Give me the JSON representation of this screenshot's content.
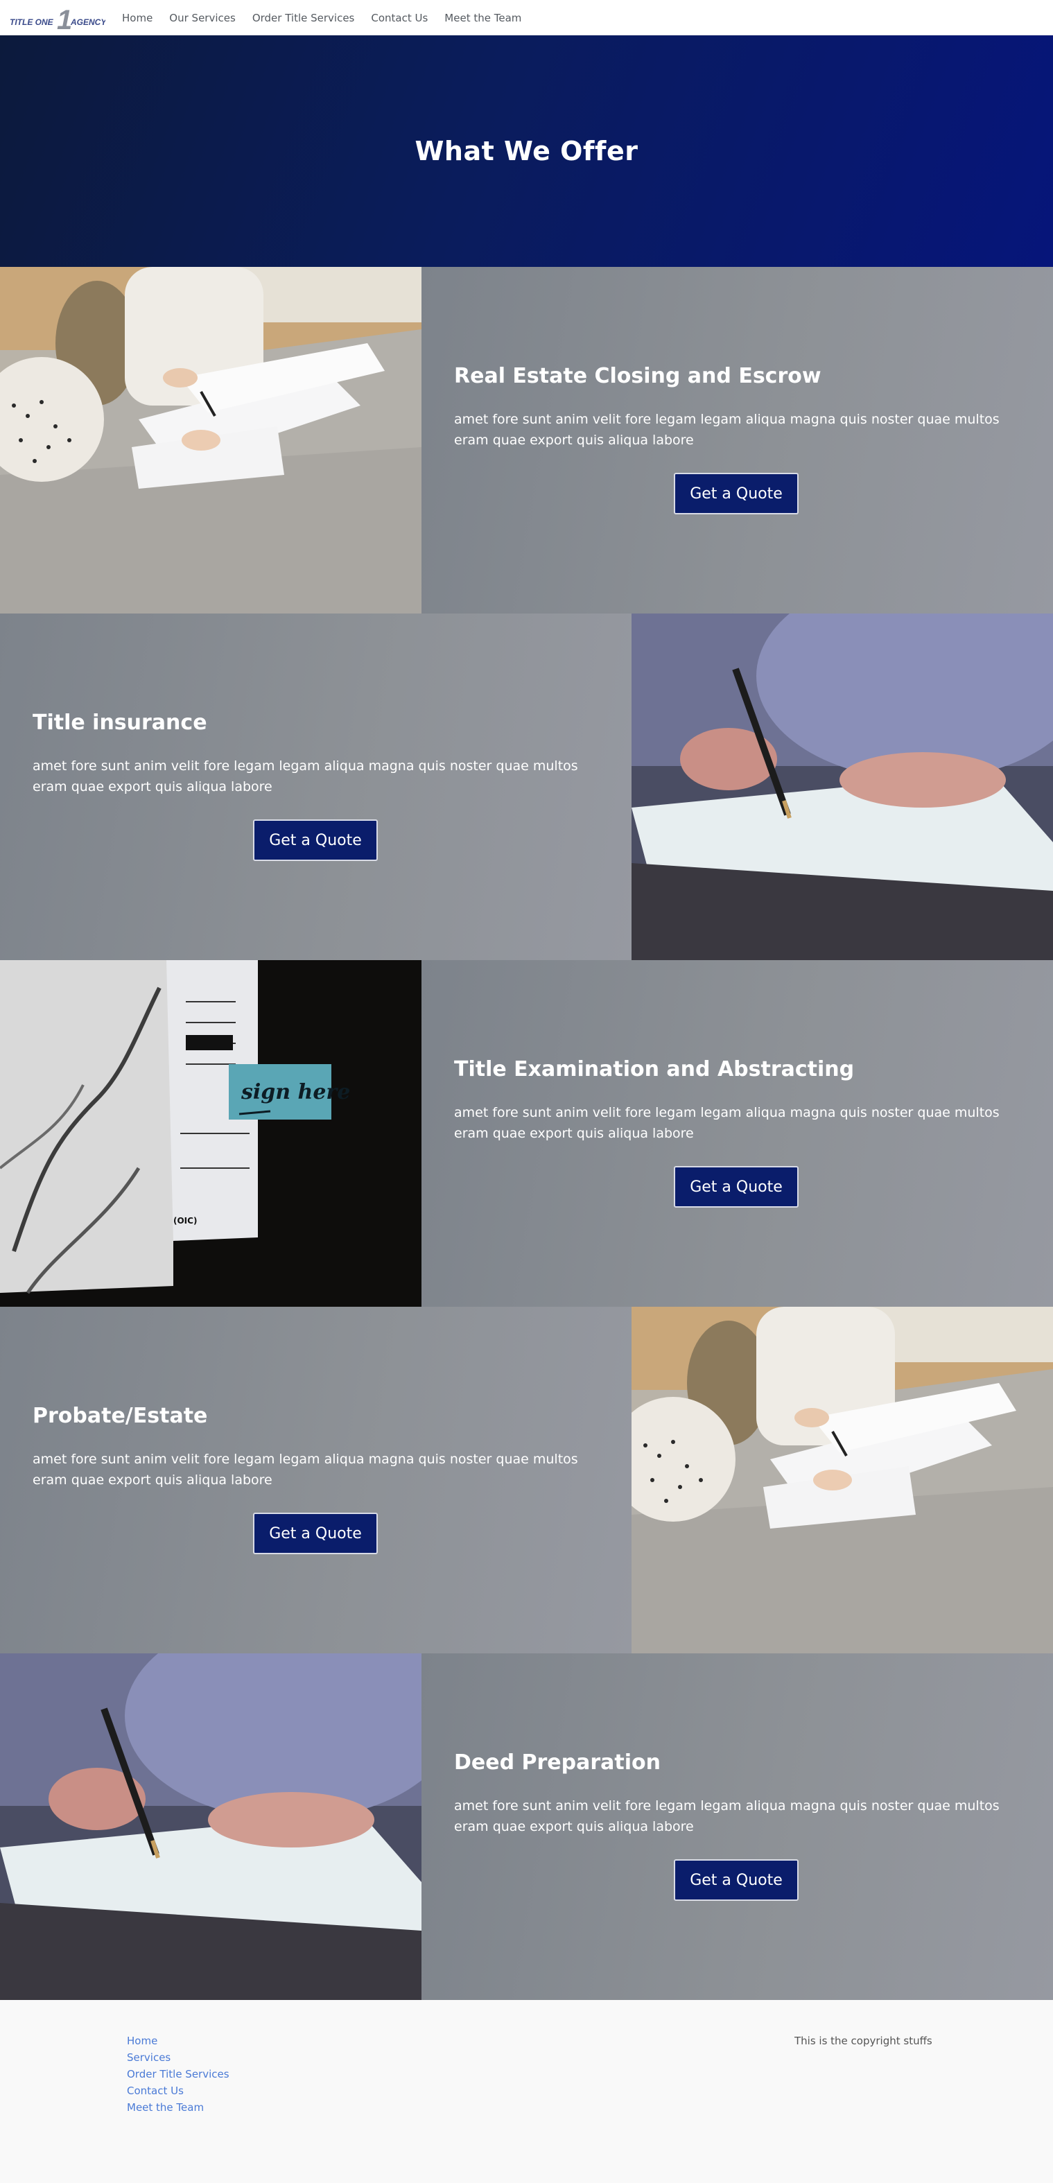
{
  "nav": {
    "logo_text": "TITLE ONE 1 AGENCY",
    "links": [
      "Home",
      "Our Services",
      "Order Title Services",
      "Contact Us",
      "Meet the Team"
    ]
  },
  "hero": {
    "title": "What We Offer"
  },
  "sections": [
    {
      "title": "Real Estate Closing and Escrow",
      "body": "amet fore sunt anim velit fore legam legam aliqua magna quis noster quae multos eram quae export quis aliqua labore",
      "button": "Get a Quote",
      "image": "women-signing-documents-photo"
    },
    {
      "title": "Title insurance",
      "body": "amet fore sunt anim velit fore legam legam aliqua magna quis noster quae multos eram quae export quis aliqua labore",
      "button": "Get a Quote",
      "image": "hand-signing-paper-photo"
    },
    {
      "title": "Title Examination and Abstracting",
      "body": "amet fore sunt anim velit fore legam legam aliqua magna quis noster quae multos eram quae export quis aliqua labore",
      "button": "Get a Quote",
      "image": "sign-here-note-photo",
      "image_text": "sign here"
    },
    {
      "title": "Probate/Estate",
      "body": "amet fore sunt anim velit fore legam legam aliqua magna quis noster quae multos eram quae export quis aliqua labore",
      "button": "Get a Quote",
      "image": "women-signing-documents-photo"
    },
    {
      "title": "Deed Preparation",
      "body": "amet fore sunt anim velit fore legam legam aliqua magna quis noster quae multos eram quae export quis aliqua labore",
      "button": "Get a Quote",
      "image": "hand-signing-paper-photo"
    }
  ],
  "footer": {
    "links": [
      "Home",
      "Services",
      "Order Title Services",
      "Contact Us",
      "Meet the Team"
    ],
    "copyright": "This is the copyright stuffs"
  },
  "colors": {
    "hero_dark": "#0c1a3c",
    "hero_blue": "#06157a",
    "button_bg": "#0a1d6b",
    "section_gray": "#8d9196",
    "footer_link": "#4a7ad6"
  }
}
